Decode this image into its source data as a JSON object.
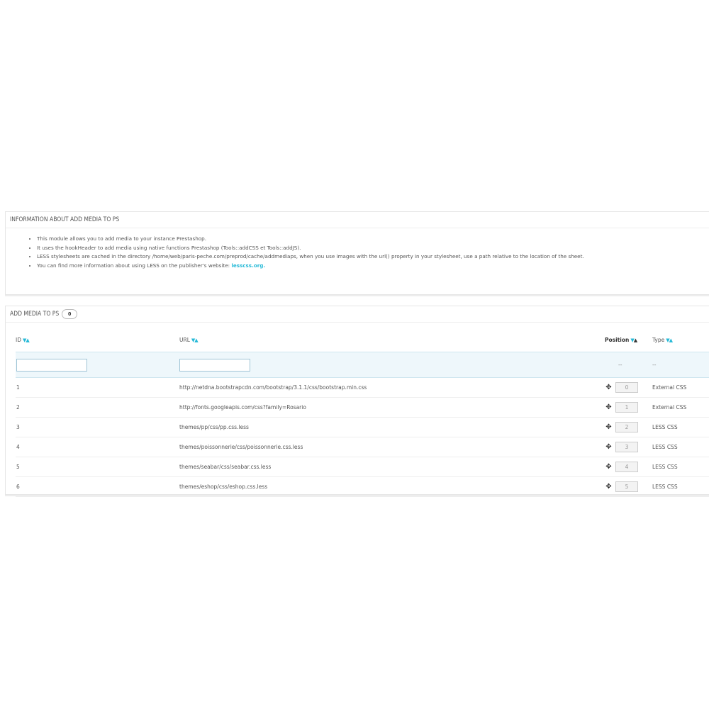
{
  "info_panel": {
    "title": "INFORMATION ABOUT ADD MEDIA TO PS",
    "items": [
      "This module allows you to add media to your instance Prestashop.",
      "It uses the hookHeader to add media using native functions Prestashop (Tools::addCSS et Tools::addJS).",
      "LESS stylesheets are cached in the directory /home/web/paris-peche.com/preprod/cache/addmediaps, when you use images with the url() property in your stylesheet, use a path relative to the location of the sheet.",
      "You can find more information about using LESS on the publisher's website: "
    ],
    "link_text": "lesscss.org."
  },
  "media_panel": {
    "title": "ADD MEDIA TO PS",
    "count": "0",
    "columns": {
      "id": "ID",
      "url": "URL",
      "position": "Position",
      "type": "Type"
    },
    "filter": {
      "position_placeholder": "--",
      "type_placeholder": "--"
    },
    "rows": [
      {
        "id": "1",
        "url": "http://netdna.bootstrapcdn.com/bootstrap/3.1.1/css/bootstrap.min.css",
        "position": "0",
        "type": "External CSS"
      },
      {
        "id": "2",
        "url": "http://fonts.googleapis.com/css?family=Rosario",
        "position": "1",
        "type": "External CSS"
      },
      {
        "id": "3",
        "url": "themes/pp/css/pp.css.less",
        "position": "2",
        "type": "LESS CSS"
      },
      {
        "id": "4",
        "url": "themes/poissonnerie/css/poissonnerie.css.less",
        "position": "3",
        "type": "LESS CSS"
      },
      {
        "id": "5",
        "url": "themes/seabar/css/seabar.css.less",
        "position": "4",
        "type": "LESS CSS"
      },
      {
        "id": "6",
        "url": "themes/eshop/css/eshop.css.less",
        "position": "5",
        "type": "LESS CSS"
      }
    ]
  }
}
